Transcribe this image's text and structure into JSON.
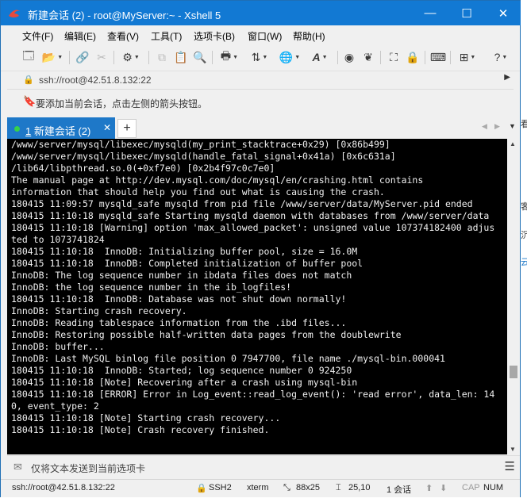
{
  "window": {
    "title": "新建会话 (2) - root@MyServer:~ - Xshell 5",
    "min_glyph": "—",
    "max_glyph": "☐",
    "close_glyph": "✕"
  },
  "menu": [
    "文件(F)",
    "编辑(E)",
    "查看(V)",
    "工具(T)",
    "选项卡(B)",
    "窗口(W)",
    "帮助(H)"
  ],
  "address": {
    "text": "ssh://root@42.51.8.132:22"
  },
  "tip": {
    "text": "要添加当前会话，点击左侧的箭头按钮。"
  },
  "tabs": [
    {
      "number": "1",
      "label": "新建会话 (2)",
      "status": "connected",
      "status_color": "#36d14a"
    }
  ],
  "tab_add": "+",
  "terminal_lines": [
    "/www/server/mysql/libexec/mysqld(my_print_stacktrace+0x29) [0x86b499]",
    "/www/server/mysql/libexec/mysqld(handle_fatal_signal+0x41a) [0x6c631a]",
    "/lib64/libpthread.so.0(+0xf7e0) [0x2b4f97c0c7e0]",
    "The manual page at http://dev.mysql.com/doc/mysql/en/crashing.html contains",
    "information that should help you find out what is causing the crash.",
    "180415 11:09:57 mysqld_safe mysqld from pid file /www/server/data/MyServer.pid ended",
    "180415 11:10:18 mysqld_safe Starting mysqld daemon with databases from /www/server/data",
    "180415 11:10:18 [Warning] option 'max_allowed_packet': unsigned value 107374182400 adjus",
    "ted to 1073741824",
    "180415 11:10:18  InnoDB: Initializing buffer pool, size = 16.0M",
    "180415 11:10:18  InnoDB: Completed initialization of buffer pool",
    "InnoDB: The log sequence number in ibdata files does not match",
    "InnoDB: the log sequence number in the ib_logfiles!",
    "180415 11:10:18  InnoDB: Database was not shut down normally!",
    "InnoDB: Starting crash recovery.",
    "InnoDB: Reading tablespace information from the .ibd files...",
    "InnoDB: Restoring possible half-written data pages from the doublewrite",
    "InnoDB: buffer...",
    "InnoDB: Last MySQL binlog file position 0 7947700, file name ./mysql-bin.000041",
    "180415 11:10:18  InnoDB: Started; log sequence number 0 924250",
    "180415 11:10:18 [Note] Recovering after a crash using mysql-bin",
    "180415 11:10:18 [ERROR] Error in Log_event::read_log_event(): 'read error', data_len: 14",
    "0, event_type: 2",
    "180415 11:10:18 [Note] Starting crash recovery...",
    "180415 11:10:18 [Note] Crash recovery finished."
  ],
  "composer": {
    "text": "仅将文本发送到当前选项卡"
  },
  "status": {
    "connection": "ssh://root@42.51.8.132:22",
    "protocol": "SSH2",
    "terminal": "xterm",
    "size": "88x25",
    "cursor": "25,10",
    "sessions": "1 会话",
    "cap": "CAP",
    "num": "NUM"
  },
  "background_glyphs": [
    "看",
    "客",
    "沉",
    "云"
  ],
  "colors": {
    "titlebar": "#1279d3",
    "tab_active": "#1e78c8",
    "terminal_bg": "#000000",
    "terminal_fg": "#f0f0f0"
  }
}
